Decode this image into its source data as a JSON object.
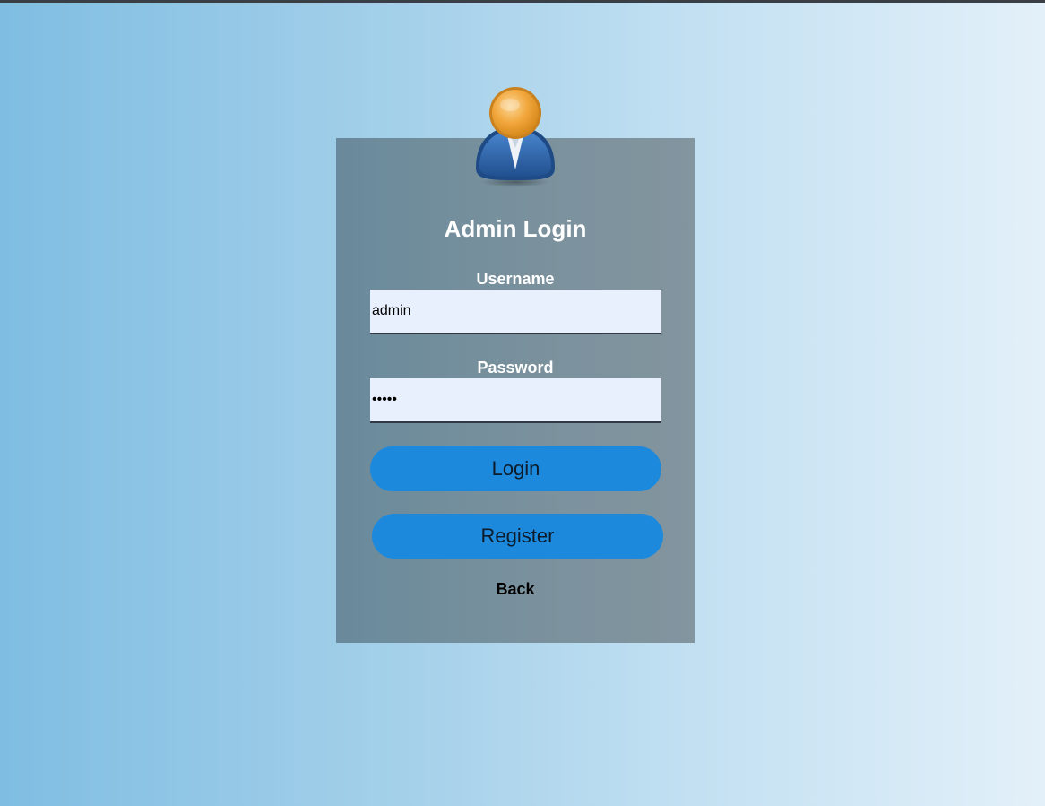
{
  "form": {
    "title": "Admin Login",
    "username_label": "Username",
    "username_value": "admin",
    "password_label": "Password",
    "password_value": "admin",
    "login_button": "Login",
    "register_button": "Register",
    "back_link": "Back"
  },
  "icons": {
    "avatar": "user-avatar-icon"
  },
  "colors": {
    "button": "#1c89dc",
    "input_background": "#e8f0fd",
    "card": "#7a919d",
    "avatar_head": "#f0a030",
    "avatar_body": "#2f63a8"
  }
}
